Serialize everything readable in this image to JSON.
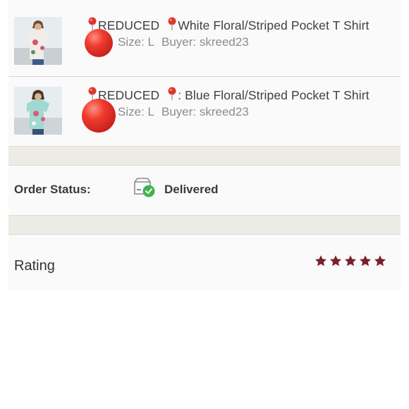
{
  "orderItems": [
    {
      "reduced_label": "REDUCED",
      "product_name": "White Floral/Striped Pocket T Shirt",
      "separator": "",
      "size": "Size: L",
      "buyer": "Buyer: skreed23",
      "thumbnail_shirt_color": "#f1ece8"
    },
    {
      "reduced_label": "REDUCED",
      "product_name": ": Blue Floral/Striped Pocket T Shirt",
      "separator": "",
      "size": "Size: L",
      "buyer": "Buyer: skreed23",
      "thumbnail_shirt_color": "#9fd9cf"
    }
  ],
  "orderStatus": {
    "label": "Order Status:",
    "value": "Delivered",
    "icon": "package-check-icon",
    "accent_color": "#3fb34f"
  },
  "rating": {
    "label": "Rating",
    "stars": 5,
    "max_stars": 5,
    "star_color": "#7b1f2b"
  },
  "colors": {
    "balloon_red": "#f03b2f",
    "spacer_bg": "#ecebe6"
  }
}
